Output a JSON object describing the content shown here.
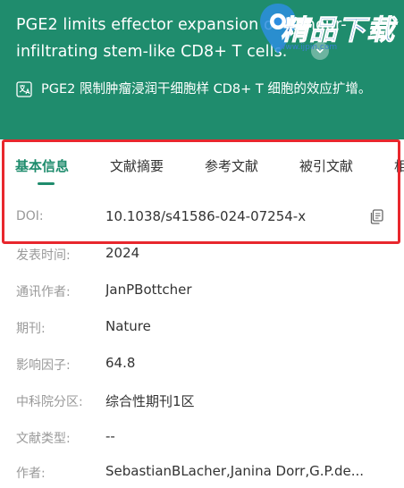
{
  "header": {
    "title": "PGE2 limits effector expansion of tumour-infiltrating stem-like CD8+ T cells.",
    "translation": "PGE2 限制肿瘤浸润干细胞样 CD8+ T 细胞的效应扩增。",
    "accent_color": "#1f8c6d",
    "expand_icon": "chevron-down-icon",
    "translate_icon": "translate-icon"
  },
  "watermark": {
    "text": "精品下载",
    "url": "www.ijpin.com"
  },
  "tabs": [
    {
      "label": "基本信息",
      "active": true
    },
    {
      "label": "文献摘要",
      "active": false
    },
    {
      "label": "参考文献",
      "active": false
    },
    {
      "label": "被引文献",
      "active": false
    },
    {
      "label": "相",
      "active": false
    }
  ],
  "info": {
    "doi": {
      "label": "DOI:",
      "value": "10.1038/s41586-024-07254-x"
    },
    "date": {
      "label": "发表时间:",
      "value": "2024"
    },
    "corresponding": {
      "label": "通讯作者:",
      "value": "JanPBottcher"
    },
    "journal": {
      "label": "期刊:",
      "value": "Nature"
    },
    "impact": {
      "label": "影响因子:",
      "value": "64.8"
    },
    "cas": {
      "label": "中科院分区:",
      "value": "综合性期刊1区"
    },
    "type": {
      "label": "文献类型:",
      "value": "--"
    },
    "authors": {
      "label": "作者:",
      "value": "SebastianBLacher,Janina Dorr,G.P.de..."
    }
  },
  "highlight_color": "#e8272d"
}
